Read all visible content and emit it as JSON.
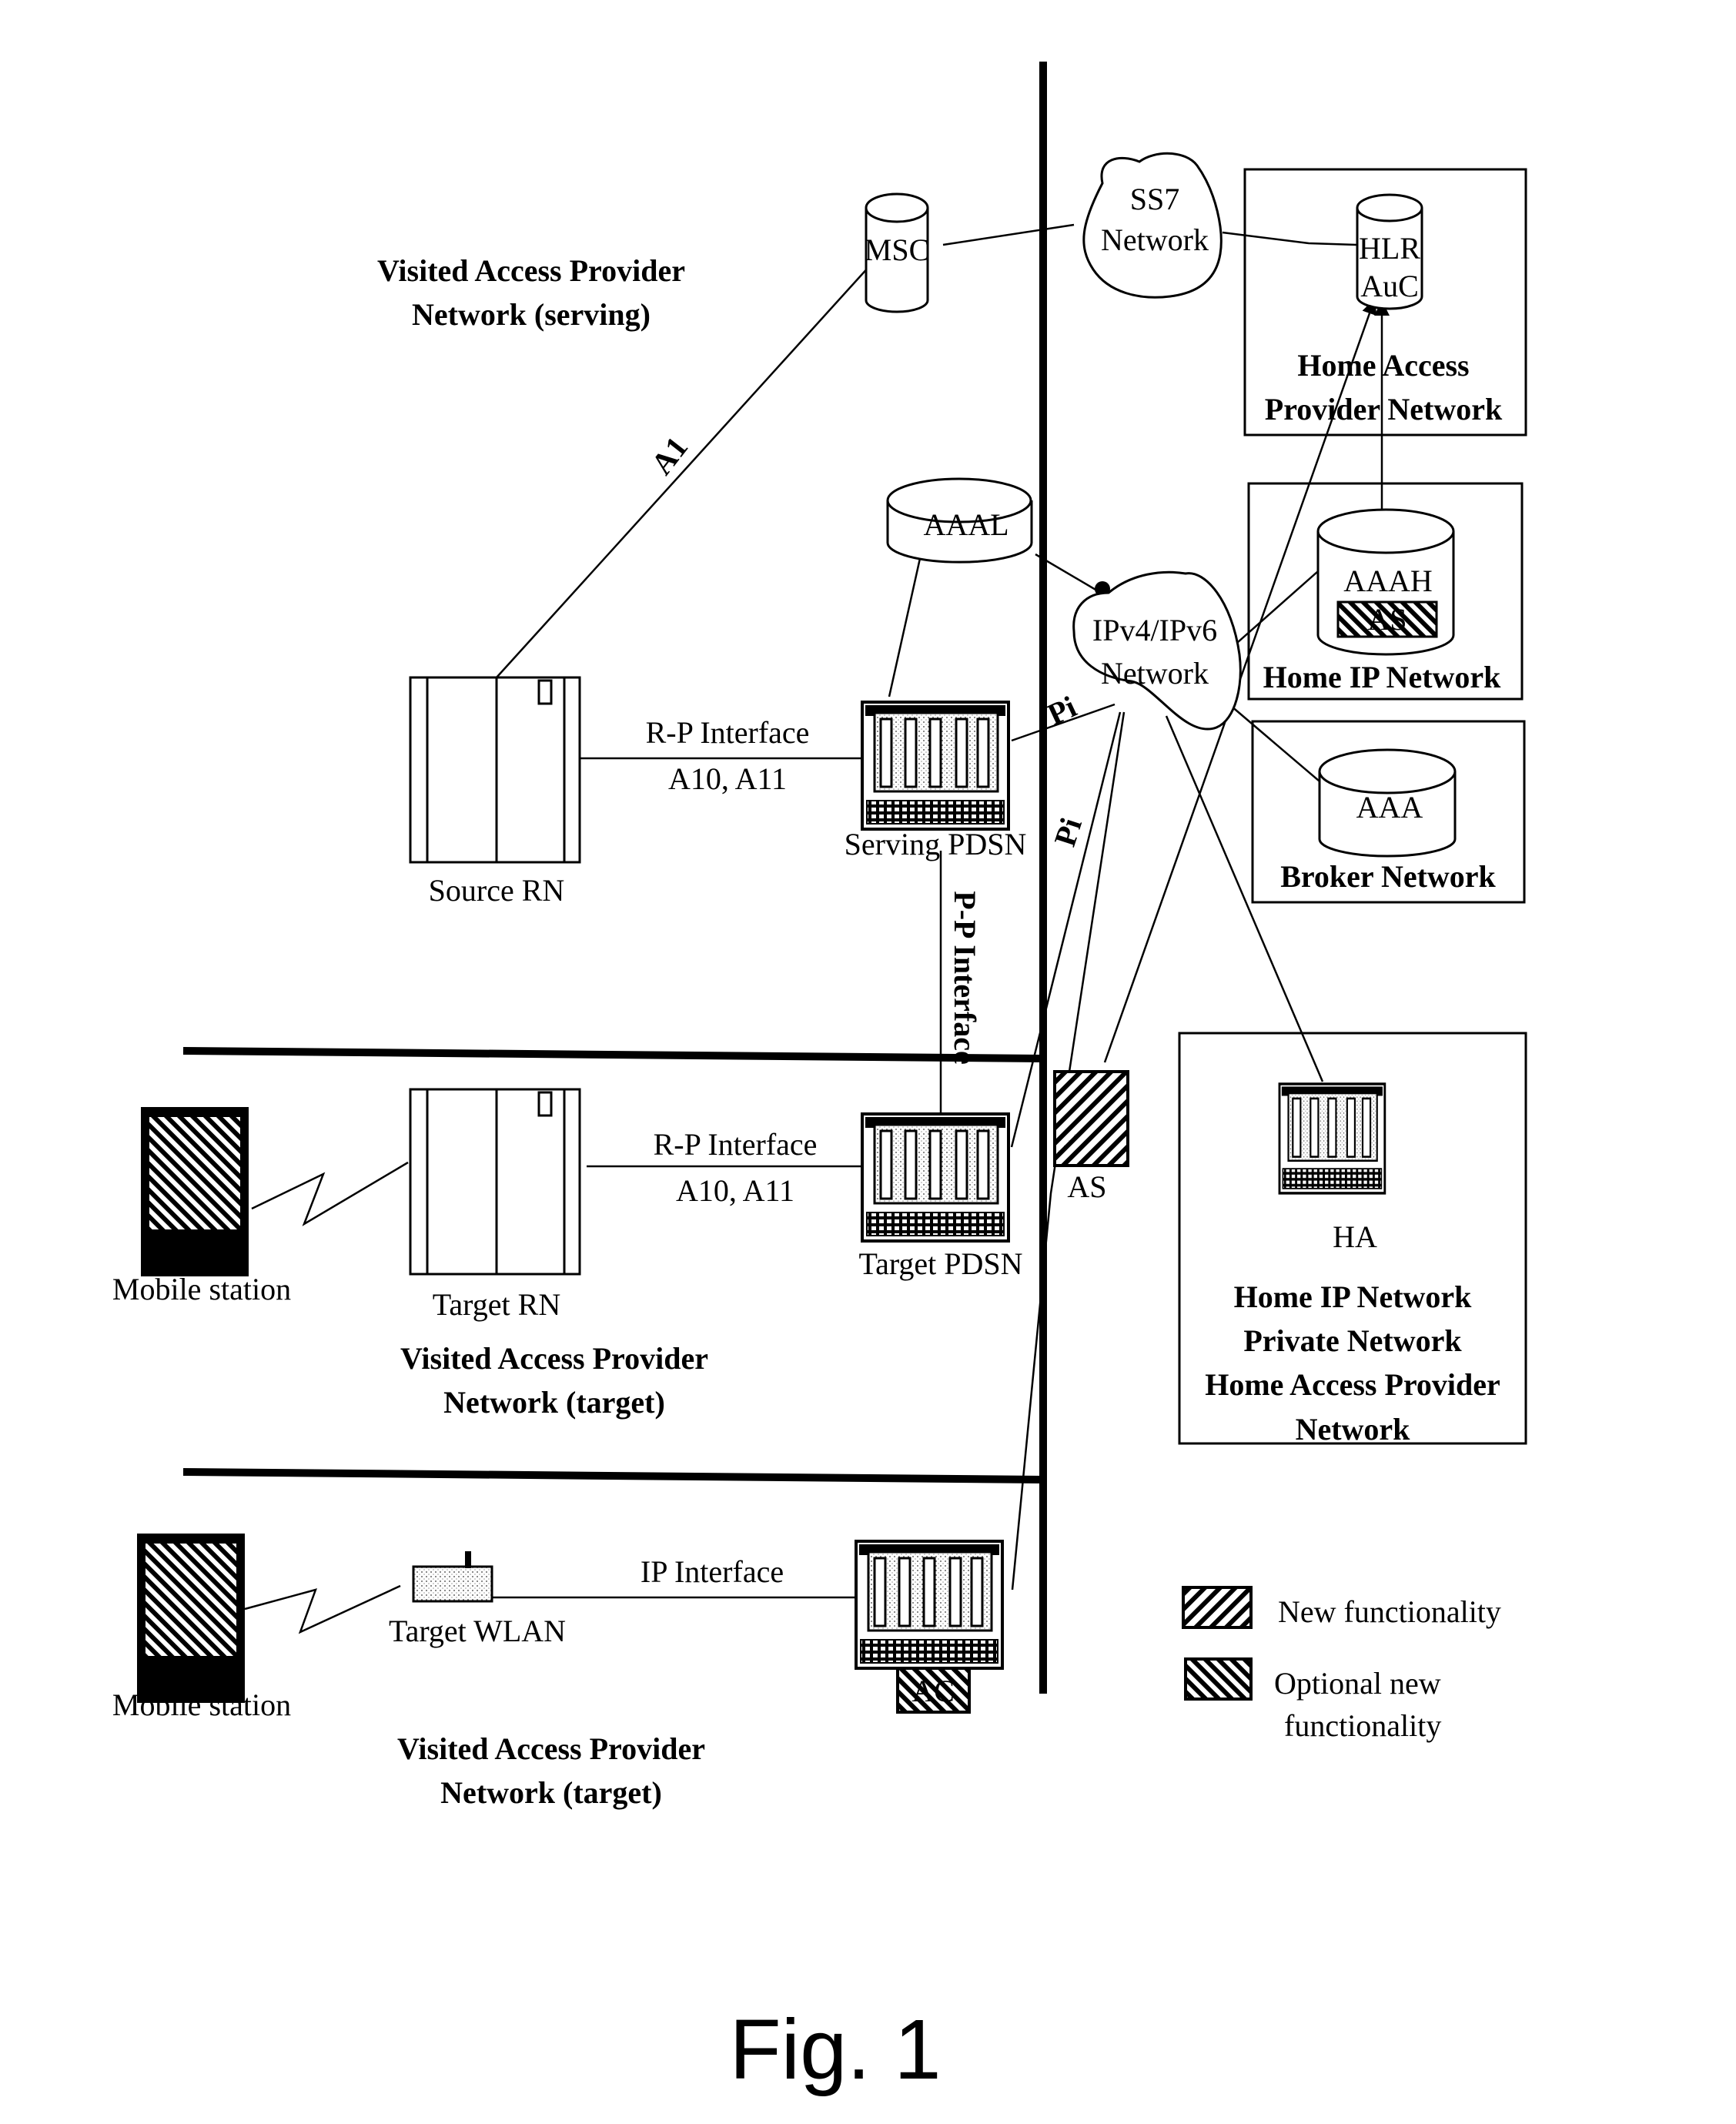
{
  "figure": {
    "caption": "Fig. 1"
  },
  "regions": {
    "visited_serving": [
      "Visited Access Provider",
      "Network (serving)"
    ],
    "visited_target_rn": [
      "Visited Access Provider",
      "Network (target)"
    ],
    "visited_target_wlan": [
      "Visited Access Provider",
      "Network (target)"
    ],
    "home_access": [
      "Home Access",
      "Provider Network"
    ],
    "home_ip": "Home IP Network",
    "broker": "Broker Network",
    "home_private": [
      "Home IP Network",
      "Private Network",
      "Home Access Provider",
      "Network"
    ]
  },
  "nodes": {
    "msc": "MSC",
    "ss7": [
      "SS7",
      "Network"
    ],
    "hlr": [
      "HLR",
      "AuC"
    ],
    "aaal": "AAAL",
    "ip_network": [
      "IPv4/IPv6",
      "Network"
    ],
    "aaah": "AAAH",
    "aaah_as": "AS",
    "aaa": "AAA",
    "source_rn": "Source RN",
    "serving_pdsn": "Serving PDSN",
    "target_rn": "Target RN",
    "target_pdsn": "Target PDSN",
    "as": "AS",
    "ha": "HA",
    "mobile_station_1": "Mobile station",
    "mobile_station_2": "Mobile station",
    "target_wlan": "Target WLAN",
    "ac": "AC"
  },
  "links": {
    "a1": "A1",
    "rp_serving": [
      "R-P Interface",
      "A10, A11"
    ],
    "rp_target": [
      "R-P Interface",
      "A10, A11"
    ],
    "pp": "P-P Interface",
    "pi_1": "Pi",
    "pi_2": "Pi",
    "ip_interface": "IP Interface"
  },
  "legend": {
    "new": "New functionality",
    "optional": [
      "Optional new",
      "functionality"
    ]
  }
}
